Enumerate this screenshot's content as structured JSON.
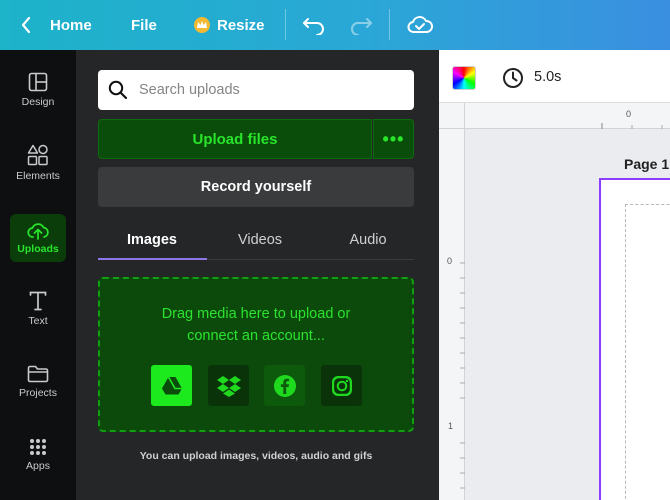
{
  "topbar": {
    "home_label": "Home",
    "file_label": "File",
    "resize_label": "Resize",
    "icons": [
      "chevron-left-icon",
      "crown-icon",
      "undo-icon",
      "redo-icon",
      "cloud-check-icon"
    ]
  },
  "sidebar": {
    "items": [
      {
        "label": "Design",
        "icon": "design-icon"
      },
      {
        "label": "Elements",
        "icon": "elements-icon"
      },
      {
        "label": "Uploads",
        "icon": "uploads-icon",
        "active": true
      },
      {
        "label": "Text",
        "icon": "text-icon"
      },
      {
        "label": "Projects",
        "icon": "folder-icon"
      },
      {
        "label": "Apps",
        "icon": "apps-icon"
      }
    ],
    "active_color": "#27e52a"
  },
  "panel": {
    "search_placeholder": "Search uploads",
    "upload_label": "Upload files",
    "more_label": "•••",
    "record_label": "Record yourself",
    "tabs": [
      {
        "label": "Images",
        "active": true
      },
      {
        "label": "Videos"
      },
      {
        "label": "Audio"
      }
    ],
    "dropzone_line1": "Drag media here to upload or",
    "dropzone_line2": "connect an account...",
    "sources": [
      "google-drive-icon",
      "dropbox-icon",
      "facebook-icon",
      "instagram-icon"
    ],
    "hint": "You can upload images, videos, audio and gifs"
  },
  "canvas": {
    "duration": "5.0s",
    "ruler_top_zero": "0",
    "ruler_left_zero": "0",
    "ruler_left_one": "1",
    "page_label": "Page 1",
    "page_border_color": "#8b3dff"
  }
}
